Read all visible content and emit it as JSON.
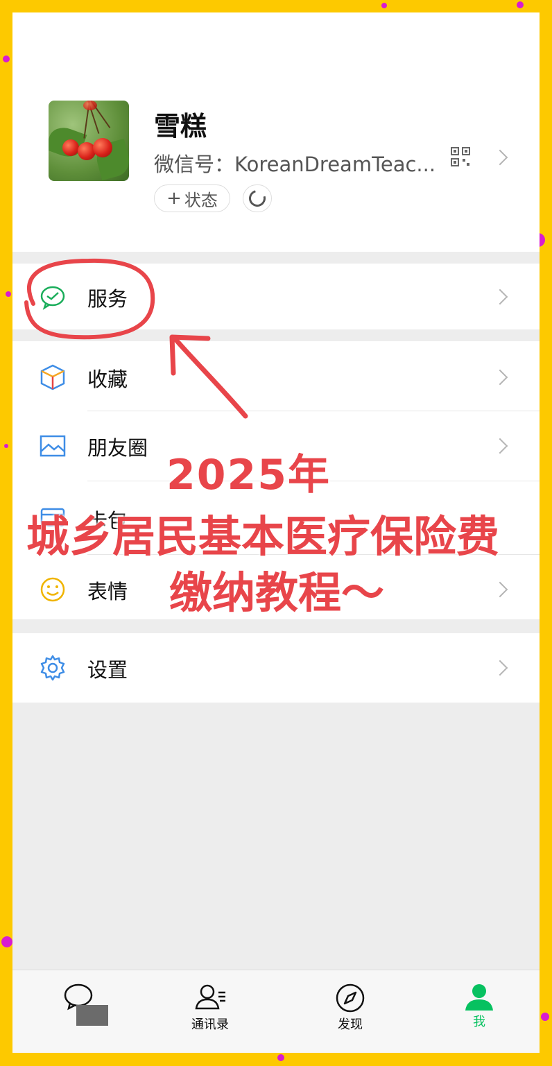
{
  "profile": {
    "nickname": "雪糕",
    "wechat_id": "微信号：KoreanDreamTeac...",
    "status_button": "状态",
    "status_plus": "+"
  },
  "menu": {
    "services": "服务",
    "favorites": "收藏",
    "moments": "朋友圈",
    "wallet": "卡包",
    "stickers": "表情",
    "settings": "设置"
  },
  "tabbar": {
    "chats": "",
    "contacts": "通讯录",
    "discover": "发现",
    "me": "我"
  },
  "overlay": {
    "line1": "2025年",
    "line2": "城乡居民基本医疗保险费",
    "line3": "缴纳教程～"
  },
  "colors": {
    "border_yellow": "#fdc900",
    "wechat_green": "#07c160",
    "annotation_red": "#e8454a",
    "dots": "#d81bd0"
  },
  "icons": {
    "services": "wechat-service-icon",
    "favorites": "cube-icon",
    "moments": "picture-icon",
    "stickers": "smiley-icon",
    "settings": "gear-icon"
  }
}
